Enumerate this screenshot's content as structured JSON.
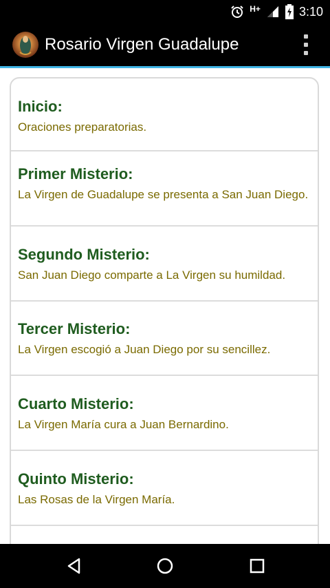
{
  "status_bar": {
    "network": "H+",
    "time": "3:10"
  },
  "app_bar": {
    "title": "Rosario Virgen Guadalupe",
    "icon": "virgin-guadalupe-avatar",
    "overflow_icon": "overflow-menu-icon"
  },
  "list": {
    "items": [
      {
        "title": "Inicio:",
        "desc": "Oraciones preparatorias."
      },
      {
        "title": "Primer Misterio:",
        "desc": "La Virgen de Guadalupe se presenta a San Juan Diego."
      },
      {
        "title": "Segundo Misterio:",
        "desc": "San Juan Diego comparte a La Virgen su humildad."
      },
      {
        "title": "Tercer Misterio:",
        "desc": "La Virgen escogió a Juan Diego por su sencillez."
      },
      {
        "title": "Cuarto Misterio:",
        "desc": "La Virgen María cura a Juan Bernardino."
      },
      {
        "title": "Quinto Misterio:",
        "desc": "Las Rosas de la Virgen María."
      }
    ]
  },
  "nav_bar": {
    "back_icon": "back-icon",
    "home_icon": "home-icon",
    "recents_icon": "recents-icon"
  },
  "colors": {
    "title_green": "#1f5c1f",
    "desc_olive": "#7a6a00",
    "accent_blue": "#40b5e6"
  }
}
